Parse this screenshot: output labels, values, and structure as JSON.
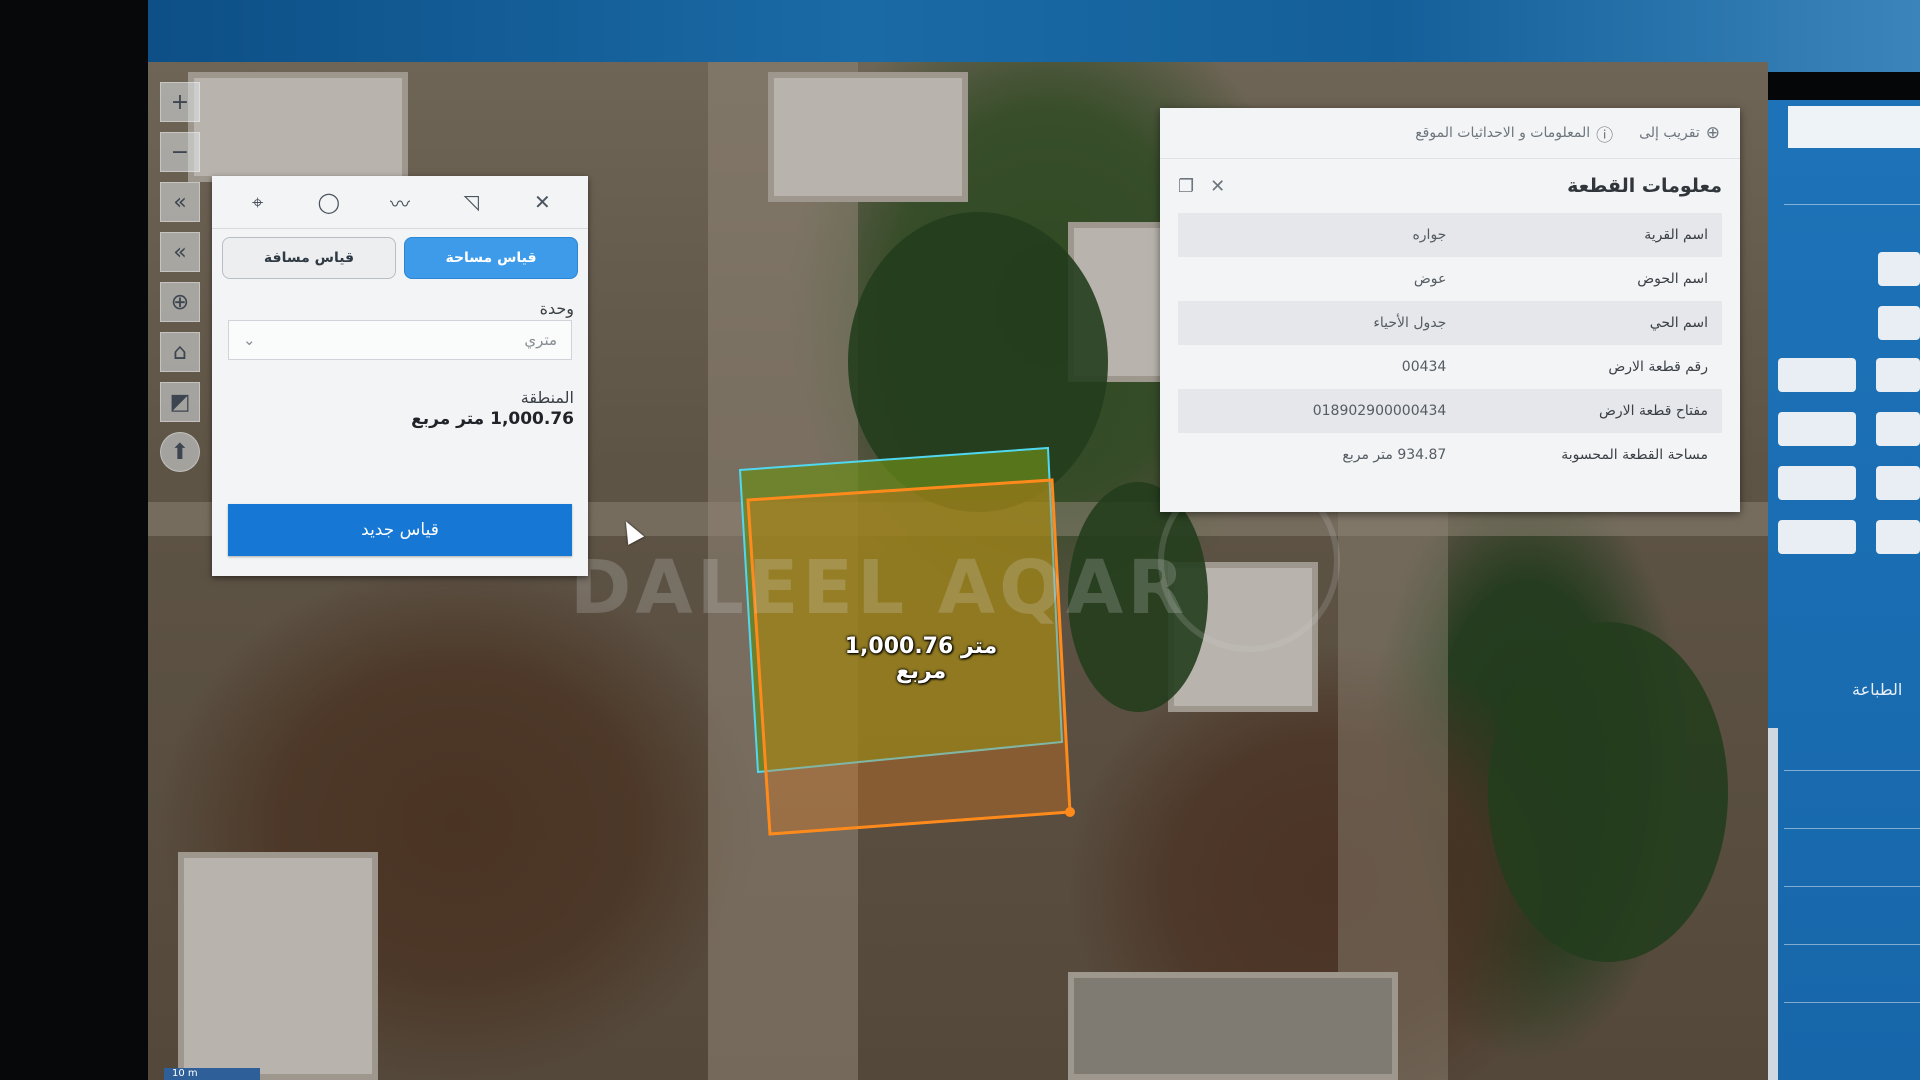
{
  "measure_panel": {
    "tabs": [
      {
        "label": "قياس مساحة",
        "active": true
      },
      {
        "label": "قياس مسافة",
        "active": false
      }
    ],
    "unit_label": "وحدة",
    "unit_value": "متري",
    "area_title": "المنطقة",
    "area_value": "1,000.76 متر مربع",
    "new_measure_label": "قياس جديد"
  },
  "map": {
    "area_label": "1,000.76 متر مربع",
    "watermark": "DALEEL AQAR",
    "scale_text": "10 m"
  },
  "info_panel": {
    "zoom_link": "تقريب إلى",
    "coords_link": "المعلومات و الاحداثيات الموقع",
    "title": "معلومات القطعة",
    "rows": [
      {
        "k": "اسم القرية",
        "v": "جواره"
      },
      {
        "k": "اسم الحوض",
        "v": "عوض"
      },
      {
        "k": "اسم الحي",
        "v": "جدول الأحياء"
      },
      {
        "k": "رقم قطعة الارض",
        "v": "00434"
      },
      {
        "k": "مفتاح قطعة الارض",
        "v": "018902900000434"
      },
      {
        "k": "مساحة القطعة المحسوبة",
        "v": "934.87 متر مربع"
      }
    ]
  },
  "right_panel": {
    "print_label": "الطباعة"
  },
  "colors": {
    "accent": "#1677d4",
    "tab_active": "#3d9be9",
    "parcel_fill": "#6b8a1a",
    "measure_outline": "#ff8a1c",
    "parcel_outline": "#4fd8f0"
  }
}
